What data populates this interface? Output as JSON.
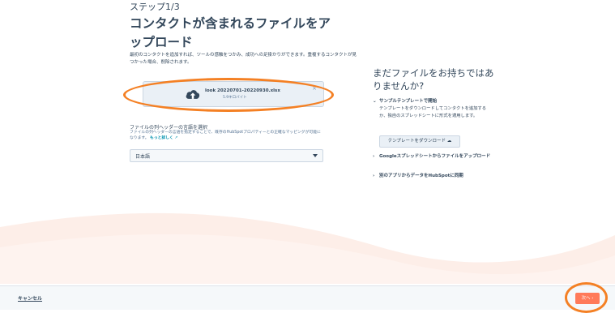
{
  "step": "ステップ1/3",
  "title": "コンタクトが含まれるファイルをアップロード",
  "description": "最初のコンタクトを追加すれば、ツールの感触をつかみ、成功への足掛かりができます。重複するコンタクトが見つかった場合、削除されます。",
  "upload": {
    "file_name": "look 20220701-20220930.xlsx",
    "file_size": "5.9キロバイト",
    "close_label": "×",
    "icon": "cloud-upload-icon"
  },
  "header_language": {
    "label": "ファイルの列ヘッダーの言語を選択",
    "help": "ファイルの列ヘッダーの言語を指定することで、既存のHubSpotプロパティーとの正確なマッピングが可能になります。",
    "more_link": "もっと詳しく",
    "selected": "日本語"
  },
  "sidebar": {
    "title": "まだファイルをお持ちではありませんか?",
    "sample_section": "サンプルテンプレートで開始",
    "sample_desc": "テンプレートをダウンロードしてコンタクトを追加するか、独自のスプレッドシートに形式を適用します。",
    "template_button": "テンプレートをダウンロード",
    "google_sheets": "Googleスプレッドシートからファイルをアップロード",
    "sync_apps": "別のアプリからデータをHubSpotに同期"
  },
  "footer": {
    "cancel": "キャンセル",
    "next": "次へ"
  },
  "colors": {
    "accent": "#ff7a59",
    "highlight": "#f48024",
    "link": "#0091ae"
  }
}
